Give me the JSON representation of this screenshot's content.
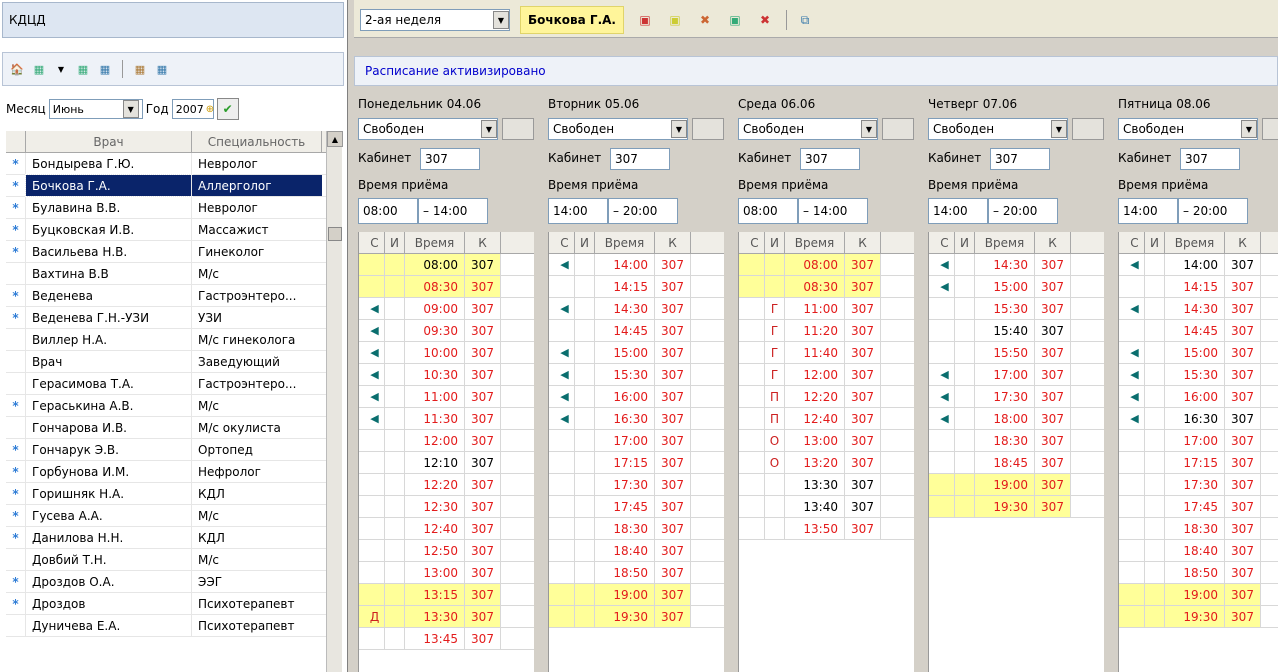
{
  "left": {
    "title": "КДЦД",
    "month_label": "Месяц",
    "month_value": "Июнь",
    "year_label": "Год",
    "year_value": "2007",
    "columns": [
      "Врач",
      "Специальность"
    ],
    "doctors": [
      {
        "mark": "*",
        "name": "Бондырева Г.Ю.",
        "spec": "Невролог"
      },
      {
        "mark": "*",
        "name": "Бочкова Г.А.",
        "spec": "Аллерголог",
        "selected": true
      },
      {
        "mark": "*",
        "name": "Булавина В.В.",
        "spec": "Невролог"
      },
      {
        "mark": "*",
        "name": "Буцковская И.В.",
        "spec": "Массажист"
      },
      {
        "mark": "*",
        "name": "Васильева Н.В.",
        "spec": "Гинеколог"
      },
      {
        "mark": "",
        "name": "Вахтина В.В",
        "spec": "М/с"
      },
      {
        "mark": "*",
        "name": "Веденева",
        "spec": "Гастроэнтеро..."
      },
      {
        "mark": "*",
        "name": "Веденева Г.Н.-УЗИ",
        "spec": "УЗИ"
      },
      {
        "mark": "",
        "name": "Виллер Н.А.",
        "spec": "М/с гинеколога"
      },
      {
        "mark": "",
        "name": "Врач",
        "spec": "Заведующий"
      },
      {
        "mark": "",
        "name": "Герасимова Т.А.",
        "spec": "Гастроэнтеро..."
      },
      {
        "mark": "*",
        "name": "Гераськина А.В.",
        "spec": "М/с"
      },
      {
        "mark": "",
        "name": "Гончарова И.В.",
        "spec": "М/с окулиста"
      },
      {
        "mark": "*",
        "name": "Гончарук Э.В.",
        "spec": "Ортопед"
      },
      {
        "mark": "*",
        "name": "Горбунова И.М.",
        "spec": "Нефролог"
      },
      {
        "mark": "*",
        "name": "Горишняк Н.А.",
        "spec": "КДЛ"
      },
      {
        "mark": "*",
        "name": "Гусева А.А.",
        "spec": "М/с"
      },
      {
        "mark": "*",
        "name": "Данилова Н.Н.",
        "spec": "КДЛ"
      },
      {
        "mark": "",
        "name": "Довбий Т.Н.",
        "spec": "М/с"
      },
      {
        "mark": "*",
        "name": "Дроздов О.А.",
        "spec": "ЭЭГ"
      },
      {
        "mark": "*",
        "name": "Дроздов",
        "spec": "Психотерапевт"
      },
      {
        "mark": "",
        "name": "Дуничева Е.А.",
        "spec": "Психотерапевт"
      }
    ]
  },
  "top": {
    "week": "2-ая неделя",
    "doctor": "Бочкова Г.А.",
    "status": "Расписание активизировано"
  },
  "labels": {
    "cabinet": "Кабинет",
    "reception_time": "Время приёма",
    "col_s": "С",
    "col_i": "И",
    "col_time": "Время",
    "col_k": "К"
  },
  "days": [
    {
      "date": "Понедельник 04.06",
      "status": "Свободен",
      "cabinet": "307",
      "from": "08:00",
      "to": "14:00",
      "rows": [
        {
          "s": "",
          "i": "",
          "t": "08:00",
          "k": "307",
          "hl": true,
          "red": false
        },
        {
          "s": "",
          "i": "",
          "t": "08:30",
          "k": "307",
          "hl": true,
          "red": true
        },
        {
          "s": "flag",
          "i": "",
          "t": "09:00",
          "k": "307",
          "hl": false,
          "red": true
        },
        {
          "s": "flag",
          "i": "",
          "t": "09:30",
          "k": "307",
          "hl": false,
          "red": true
        },
        {
          "s": "flag",
          "i": "",
          "t": "10:00",
          "k": "307",
          "hl": false,
          "red": true
        },
        {
          "s": "flag",
          "i": "",
          "t": "10:30",
          "k": "307",
          "hl": false,
          "red": true
        },
        {
          "s": "flag",
          "i": "",
          "t": "11:00",
          "k": "307",
          "hl": false,
          "red": true
        },
        {
          "s": "flag",
          "i": "",
          "t": "11:30",
          "k": "307",
          "hl": false,
          "red": true
        },
        {
          "s": "",
          "i": "",
          "t": "12:00",
          "k": "307",
          "hl": false,
          "red": true
        },
        {
          "s": "",
          "i": "",
          "t": "12:10",
          "k": "307",
          "hl": false,
          "red": false
        },
        {
          "s": "",
          "i": "",
          "t": "12:20",
          "k": "307",
          "hl": false,
          "red": true
        },
        {
          "s": "",
          "i": "",
          "t": "12:30",
          "k": "307",
          "hl": false,
          "red": true
        },
        {
          "s": "",
          "i": "",
          "t": "12:40",
          "k": "307",
          "hl": false,
          "red": true
        },
        {
          "s": "",
          "i": "",
          "t": "12:50",
          "k": "307",
          "hl": false,
          "red": true
        },
        {
          "s": "",
          "i": "",
          "t": "13:00",
          "k": "307",
          "hl": false,
          "red": true
        },
        {
          "s": "",
          "i": "",
          "t": "13:15",
          "k": "307",
          "hl": true,
          "red": true
        },
        {
          "s": "Д",
          "i": "",
          "t": "13:30",
          "k": "307",
          "hl": true,
          "red": true
        },
        {
          "s": "",
          "i": "",
          "t": "13:45",
          "k": "307",
          "hl": false,
          "red": true
        }
      ]
    },
    {
      "date": "Вторник 05.06",
      "status": "Свободен",
      "cabinet": "307",
      "from": "14:00",
      "to": "20:00",
      "rows": [
        {
          "s": "flag",
          "i": "",
          "t": "14:00",
          "k": "307",
          "hl": false,
          "red": true
        },
        {
          "s": "",
          "i": "",
          "t": "14:15",
          "k": "307",
          "hl": false,
          "red": true
        },
        {
          "s": "flag",
          "i": "",
          "t": "14:30",
          "k": "307",
          "hl": false,
          "red": true
        },
        {
          "s": "",
          "i": "",
          "t": "14:45",
          "k": "307",
          "hl": false,
          "red": true
        },
        {
          "s": "flag",
          "i": "",
          "t": "15:00",
          "k": "307",
          "hl": false,
          "red": true
        },
        {
          "s": "flag",
          "i": "",
          "t": "15:30",
          "k": "307",
          "hl": false,
          "red": true
        },
        {
          "s": "flag",
          "i": "",
          "t": "16:00",
          "k": "307",
          "hl": false,
          "red": true
        },
        {
          "s": "flag",
          "i": "",
          "t": "16:30",
          "k": "307",
          "hl": false,
          "red": true
        },
        {
          "s": "",
          "i": "",
          "t": "17:00",
          "k": "307",
          "hl": false,
          "red": true
        },
        {
          "s": "",
          "i": "",
          "t": "17:15",
          "k": "307",
          "hl": false,
          "red": true
        },
        {
          "s": "",
          "i": "",
          "t": "17:30",
          "k": "307",
          "hl": false,
          "red": true
        },
        {
          "s": "",
          "i": "",
          "t": "17:45",
          "k": "307",
          "hl": false,
          "red": true
        },
        {
          "s": "",
          "i": "",
          "t": "18:30",
          "k": "307",
          "hl": false,
          "red": true
        },
        {
          "s": "",
          "i": "",
          "t": "18:40",
          "k": "307",
          "hl": false,
          "red": true
        },
        {
          "s": "",
          "i": "",
          "t": "18:50",
          "k": "307",
          "hl": false,
          "red": true
        },
        {
          "s": "",
          "i": "",
          "t": "19:00",
          "k": "307",
          "hl": true,
          "red": true
        },
        {
          "s": "",
          "i": "",
          "t": "19:30",
          "k": "307",
          "hl": true,
          "red": true
        }
      ]
    },
    {
      "date": "Среда 06.06",
      "status": "Свободен",
      "cabinet": "307",
      "from": "08:00",
      "to": "14:00",
      "rows": [
        {
          "s": "",
          "i": "",
          "t": "08:00",
          "k": "307",
          "hl": true,
          "red": true
        },
        {
          "s": "",
          "i": "",
          "t": "08:30",
          "k": "307",
          "hl": true,
          "red": true
        },
        {
          "s": "",
          "i": "Г",
          "t": "11:00",
          "k": "307",
          "hl": false,
          "red": true
        },
        {
          "s": "",
          "i": "Г",
          "t": "11:20",
          "k": "307",
          "hl": false,
          "red": true
        },
        {
          "s": "",
          "i": "Г",
          "t": "11:40",
          "k": "307",
          "hl": false,
          "red": true
        },
        {
          "s": "",
          "i": "Г",
          "t": "12:00",
          "k": "307",
          "hl": false,
          "red": true
        },
        {
          "s": "",
          "i": "П",
          "t": "12:20",
          "k": "307",
          "hl": false,
          "red": true
        },
        {
          "s": "",
          "i": "П",
          "t": "12:40",
          "k": "307",
          "hl": false,
          "red": true
        },
        {
          "s": "",
          "i": "О",
          "t": "13:00",
          "k": "307",
          "hl": false,
          "red": true
        },
        {
          "s": "",
          "i": "О",
          "t": "13:20",
          "k": "307",
          "hl": false,
          "red": true
        },
        {
          "s": "",
          "i": "",
          "t": "13:30",
          "k": "307",
          "hl": false,
          "red": false
        },
        {
          "s": "",
          "i": "",
          "t": "13:40",
          "k": "307",
          "hl": false,
          "red": false
        },
        {
          "s": "",
          "i": "",
          "t": "13:50",
          "k": "307",
          "hl": false,
          "red": true
        }
      ]
    },
    {
      "date": "Четверг 07.06",
      "status": "Свободен",
      "cabinet": "307",
      "from": "14:00",
      "to": "20:00",
      "rows": [
        {
          "s": "flag",
          "i": "",
          "t": "14:30",
          "k": "307",
          "hl": false,
          "red": true
        },
        {
          "s": "flag",
          "i": "",
          "t": "15:00",
          "k": "307",
          "hl": false,
          "red": true
        },
        {
          "s": "",
          "i": "",
          "t": "15:30",
          "k": "307",
          "hl": false,
          "red": true
        },
        {
          "s": "",
          "i": "",
          "t": "15:40",
          "k": "307",
          "hl": false,
          "red": false
        },
        {
          "s": "",
          "i": "",
          "t": "15:50",
          "k": "307",
          "hl": false,
          "red": true
        },
        {
          "s": "flag",
          "i": "",
          "t": "17:00",
          "k": "307",
          "hl": false,
          "red": true
        },
        {
          "s": "flag",
          "i": "",
          "t": "17:30",
          "k": "307",
          "hl": false,
          "red": true
        },
        {
          "s": "flag",
          "i": "",
          "t": "18:00",
          "k": "307",
          "hl": false,
          "red": true
        },
        {
          "s": "",
          "i": "",
          "t": "18:30",
          "k": "307",
          "hl": false,
          "red": true
        },
        {
          "s": "",
          "i": "",
          "t": "18:45",
          "k": "307",
          "hl": false,
          "red": true
        },
        {
          "s": "",
          "i": "",
          "t": "19:00",
          "k": "307",
          "hl": true,
          "red": true
        },
        {
          "s": "",
          "i": "",
          "t": "19:30",
          "k": "307",
          "hl": true,
          "red": true
        }
      ]
    },
    {
      "date": "Пятница 08.06",
      "status": "Свободен",
      "cabinet": "307",
      "from": "14:00",
      "to": "20:00",
      "rows": [
        {
          "s": "flag",
          "i": "",
          "t": "14:00",
          "k": "307",
          "hl": false,
          "red": false
        },
        {
          "s": "",
          "i": "",
          "t": "14:15",
          "k": "307",
          "hl": false,
          "red": true
        },
        {
          "s": "flag",
          "i": "",
          "t": "14:30",
          "k": "307",
          "hl": false,
          "red": true
        },
        {
          "s": "",
          "i": "",
          "t": "14:45",
          "k": "307",
          "hl": false,
          "red": true
        },
        {
          "s": "flag",
          "i": "",
          "t": "15:00",
          "k": "307",
          "hl": false,
          "red": true
        },
        {
          "s": "flag",
          "i": "",
          "t": "15:30",
          "k": "307",
          "hl": false,
          "red": true
        },
        {
          "s": "flag",
          "i": "",
          "t": "16:00",
          "k": "307",
          "hl": false,
          "red": true
        },
        {
          "s": "flag",
          "i": "",
          "t": "16:30",
          "k": "307",
          "hl": false,
          "red": false
        },
        {
          "s": "",
          "i": "",
          "t": "17:00",
          "k": "307",
          "hl": false,
          "red": true
        },
        {
          "s": "",
          "i": "",
          "t": "17:15",
          "k": "307",
          "hl": false,
          "red": true
        },
        {
          "s": "",
          "i": "",
          "t": "17:30",
          "k": "307",
          "hl": false,
          "red": true
        },
        {
          "s": "",
          "i": "",
          "t": "17:45",
          "k": "307",
          "hl": false,
          "red": true
        },
        {
          "s": "",
          "i": "",
          "t": "18:30",
          "k": "307",
          "hl": false,
          "red": true
        },
        {
          "s": "",
          "i": "",
          "t": "18:40",
          "k": "307",
          "hl": false,
          "red": true
        },
        {
          "s": "",
          "i": "",
          "t": "18:50",
          "k": "307",
          "hl": false,
          "red": true
        },
        {
          "s": "",
          "i": "",
          "t": "19:00",
          "k": "307",
          "hl": true,
          "red": true
        },
        {
          "s": "",
          "i": "",
          "t": "19:30",
          "k": "307",
          "hl": true,
          "red": true
        }
      ]
    }
  ]
}
